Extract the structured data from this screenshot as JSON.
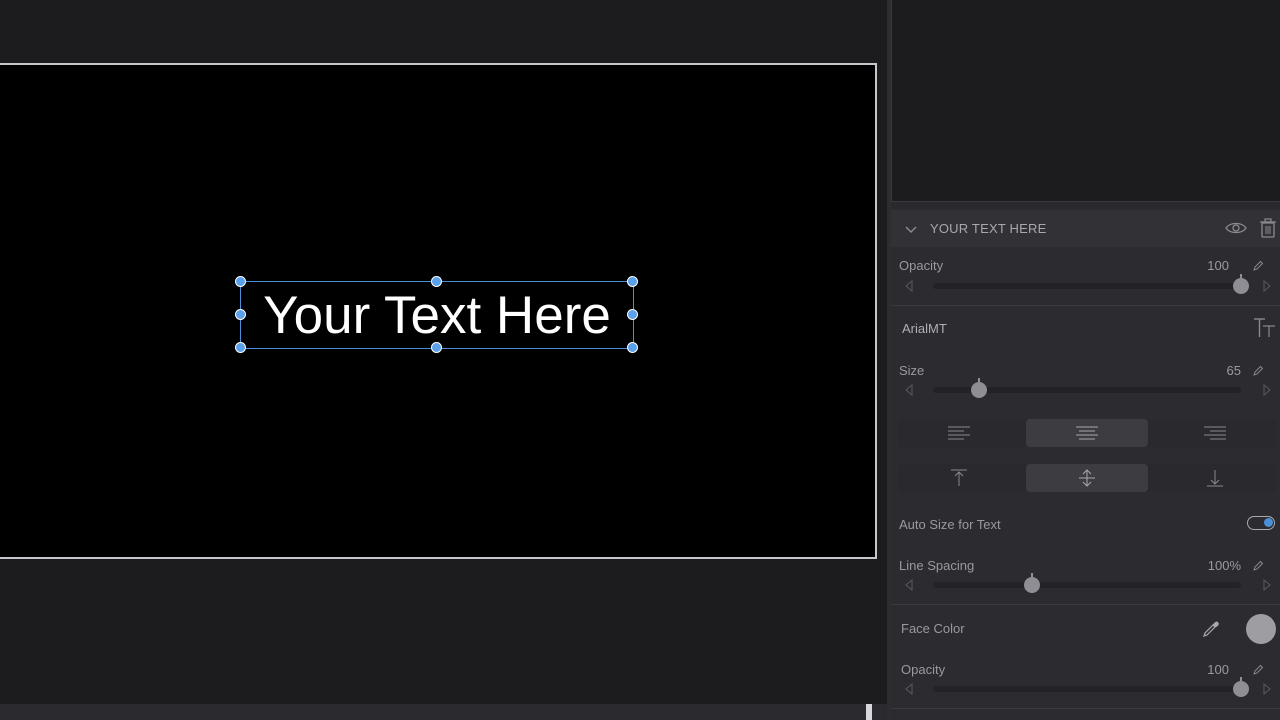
{
  "canvas": {
    "text": "Your Text Here"
  },
  "inspector": {
    "title": "YOUR TEXT HERE",
    "opacity": {
      "label": "Opacity",
      "value": "100",
      "level": 1.0
    },
    "font": {
      "name": "ArialMT"
    },
    "size": {
      "label": "Size",
      "value": "65",
      "level": 0.15
    },
    "horizontal_align": {
      "options": [
        "left",
        "center",
        "right"
      ],
      "selected": "center"
    },
    "vertical_align": {
      "options": [
        "top",
        "middle",
        "bottom"
      ],
      "selected": "middle"
    },
    "auto_size": {
      "label": "Auto Size for Text",
      "enabled": true
    },
    "line_spacing": {
      "label": "Line Spacing",
      "value": "100%",
      "level": 0.32
    },
    "face_color": {
      "label": "Face Color",
      "color": "#9e9ea2"
    },
    "face_opacity": {
      "label": "Opacity",
      "value": "100",
      "level": 1.0
    }
  },
  "colors": {
    "accent": "#4a8fd9",
    "background": "#1c1b1e",
    "panel": "#2c2b2f"
  }
}
